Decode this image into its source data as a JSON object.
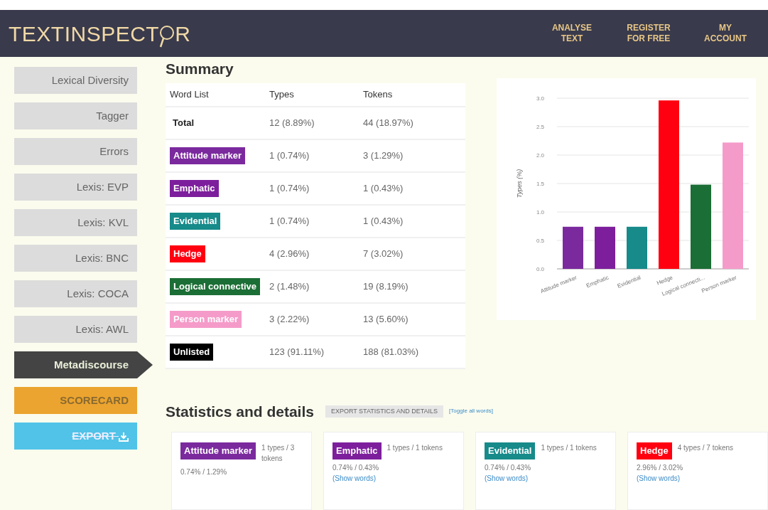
{
  "header": {
    "logo": "**TEXT**INSPECT",
    "logo_end": "R",
    "nav": [
      "ANALYSE TEXT",
      "REGISTER FOR FREE",
      "MY ACCOUNT"
    ]
  },
  "sidebar": {
    "items": [
      {
        "label": "Lexical Diversity",
        "selected": false
      },
      {
        "label": "Tagger",
        "selected": false
      },
      {
        "label": "Errors",
        "selected": false
      },
      {
        "label": "Lexis: EVP",
        "selected": false
      },
      {
        "label": "Lexis: KVL",
        "selected": false
      },
      {
        "label": "Lexis: BNC",
        "selected": false
      },
      {
        "label": "Lexis: COCA",
        "selected": false
      },
      {
        "label": "Lexis: AWL",
        "selected": false
      },
      {
        "label": "Metadiscourse",
        "selected": true
      }
    ],
    "scorecard": "SCORECARD",
    "export": "EXPORT"
  },
  "summary": {
    "title": "Summary",
    "columns": [
      "Word List",
      "Types",
      "Tokens"
    ],
    "rows": [
      {
        "kind": "plain",
        "label": "Total",
        "types": "12 (8.89%)",
        "tokens": "44 (18.97%)"
      },
      {
        "kind": "tag",
        "label": "Attitude marker",
        "color": "#7b2a9e",
        "types": "1 (0.74%)",
        "tokens": "3 (1.29%)"
      },
      {
        "kind": "tag",
        "label": "Emphatic",
        "color": "#7d1f9c",
        "types": "1 (0.74%)",
        "tokens": "1 (0.43%)"
      },
      {
        "kind": "tag",
        "label": "Evidential",
        "color": "#178a8a",
        "types": "1 (0.74%)",
        "tokens": "1 (0.43%)"
      },
      {
        "kind": "tag",
        "label": "Hedge",
        "color": "#ff0010",
        "types": "4 (2.96%)",
        "tokens": "7 (3.02%)"
      },
      {
        "kind": "tag",
        "label": "Logical connective",
        "color": "#1b6e35",
        "types": "2 (1.48%)",
        "tokens": "19 (8.19%)"
      },
      {
        "kind": "tag",
        "label": "Person marker",
        "color": "#f59bc9",
        "types": "3 (2.22%)",
        "tokens": "13 (5.60%)"
      },
      {
        "kind": "tag",
        "label": "Unlisted",
        "color": "#000000",
        "types": "123 (91.11%)",
        "tokens": "188 (81.03%)"
      }
    ],
    "chart_data": {
      "type": "bar",
      "ylabel": "Types (%)",
      "categories": [
        "Attitude marker",
        "Emphatic",
        "Evidential",
        "Hedge",
        "Logical connecti...",
        "Person marker"
      ],
      "values": [
        0.74,
        0.74,
        0.74,
        2.96,
        1.48,
        2.22
      ],
      "grid": true,
      "colors": [
        "#7b2a9e",
        "#7d1f9c",
        "#178a8a",
        "#ff0010",
        "#1b6e35",
        "#f59bc9"
      ],
      "ylim": [
        0,
        3
      ],
      "yticks": [
        {
          "value": 0,
          "label": "0.0"
        },
        {
          "value": 0.5,
          "label": "0.5"
        },
        {
          "value": 1,
          "label": "1.0"
        },
        {
          "value": 1.5,
          "label": "1.5"
        },
        {
          "value": 2,
          "label": "2.0"
        },
        {
          "value": 2.5,
          "label": "2.5"
        },
        {
          "value": 3,
          "label": "3.0"
        }
      ]
    }
  },
  "statistics": {
    "title": "Statistics and details",
    "export_button": "EXPORT STATISTICS AND DETAILS",
    "toggle_link": "[Toggle all words]",
    "cards": [
      {
        "label": "Attitude marker",
        "color": "#7b2a9e",
        "counts": "1 types / 3 tokens",
        "percent": "0.74% / 1.29%"
      },
      {
        "label": "Emphatic",
        "color": "#7d1f9c",
        "counts": "1 types / 1 tokens",
        "percent": "0.74% / 0.43%",
        "link": "(Show words)"
      },
      {
        "label": "Evidential",
        "color": "#178a8a",
        "counts": "1 types / 1 tokens",
        "percent": "0.74% / 0.43%",
        "link": "(Show words)"
      },
      {
        "label": "Hedge",
        "color": "#ff0010",
        "counts": "4 types / 7 tokens",
        "percent": "2.96% / 3.02%",
        "link": "(Show words)"
      }
    ]
  }
}
